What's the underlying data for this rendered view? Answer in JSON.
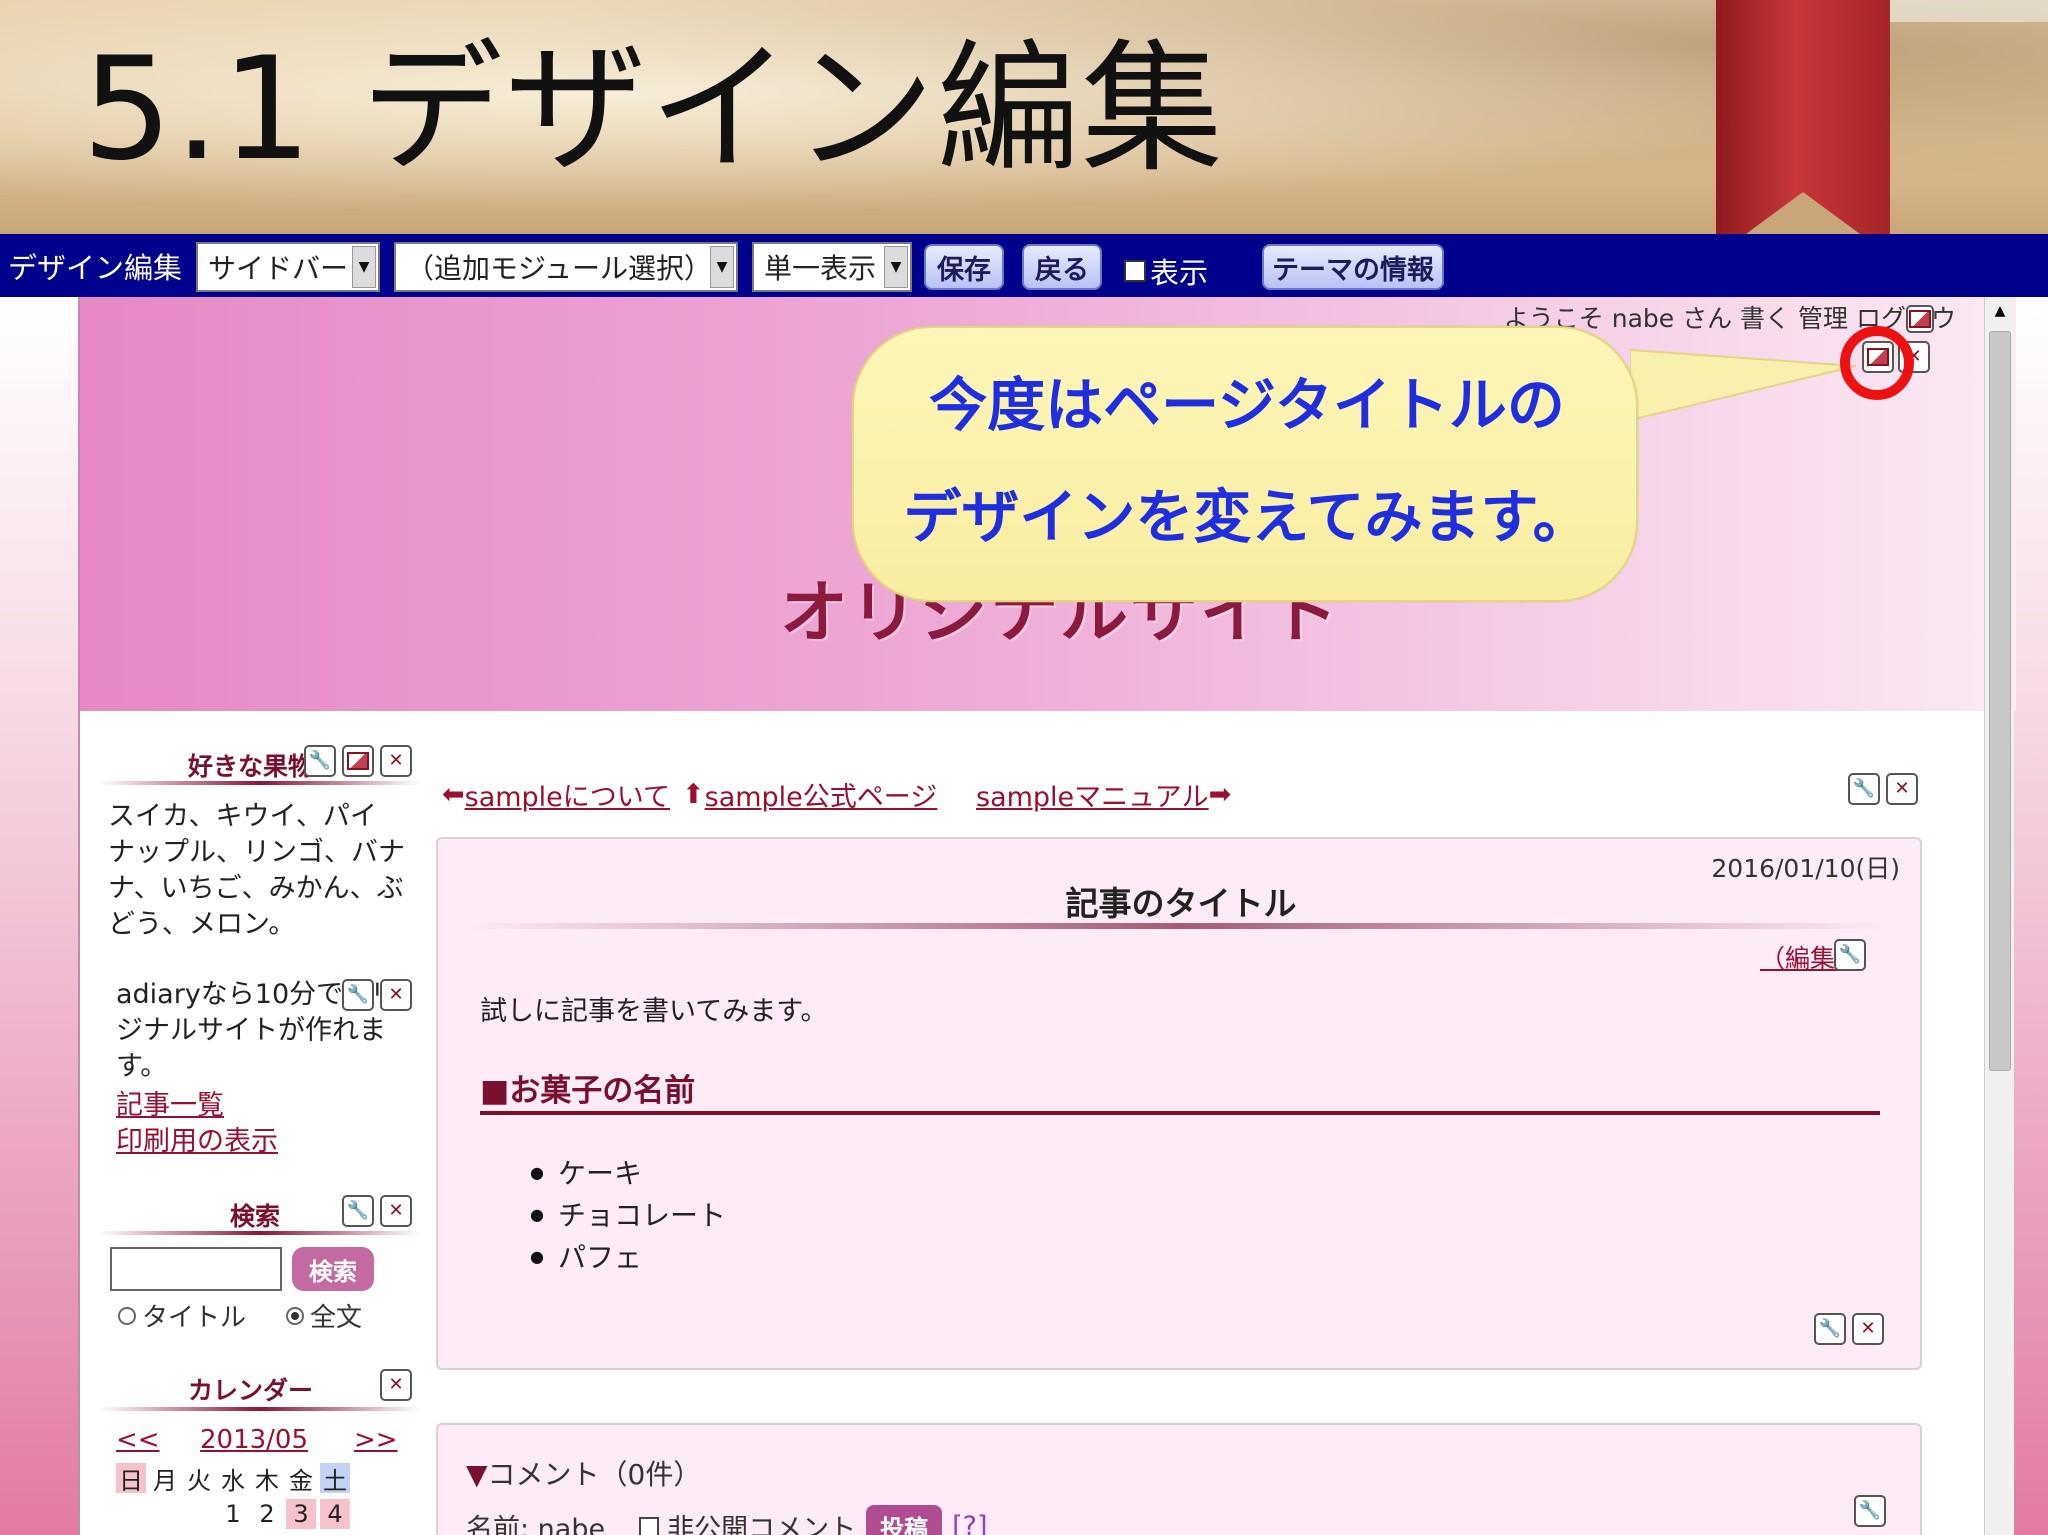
{
  "slide": {
    "title": "5.1 デザイン編集"
  },
  "toolbar": {
    "label": "デザイン編集",
    "select_sidebar": "サイドバー",
    "select_module": "（追加モジュール選択）",
    "select_view": "単一表示",
    "save_label": "保存",
    "back_label": "戻る",
    "display_checkbox_label": "表示",
    "theme_info_label": "テーマの情報"
  },
  "header": {
    "welcome": "ようこそ nabe さん",
    "write_link": "書く",
    "admin_link": "管理",
    "logout_link": "ログアウ",
    "site_title": "オリジナルサイト"
  },
  "callout": {
    "line1": "今度はページタイトルの",
    "line2": "デザインを変えてみます。"
  },
  "sidebar": {
    "fruits": {
      "heading": "好きな果物",
      "text_lines": [
        "スイカ、キウイ、パイ",
        "ナップル、リンゴ、バナ",
        "ナ、いちご、みかん、ぶ",
        "どう、メロン。"
      ]
    },
    "adiary": {
      "text_lines": [
        "adiaryなら10分でオリ",
        "ジナルサイトが作れま",
        "す。"
      ],
      "link_articles": "記事一覧",
      "link_print": "印刷用の表示"
    },
    "search": {
      "heading": "検索",
      "button": "検索",
      "radio_title": "タイトル",
      "radio_full": "全文"
    },
    "calendar": {
      "heading": "カレンダー",
      "prev": "<<",
      "month": "2013/05",
      "next": ">>",
      "weekdays": [
        "日",
        "月",
        "火",
        "水",
        "木",
        "金",
        "土"
      ],
      "first_row": [
        "1",
        "2",
        "3",
        "4"
      ]
    }
  },
  "main": {
    "nav": {
      "prev": "sampleについて",
      "up": "sample公式ページ",
      "next": "sampleマニュアル"
    },
    "article": {
      "date": "2016/01/10(日)",
      "title": "記事のタイトル",
      "edit": "（編集）",
      "body": "試しに記事を書いてみます。",
      "heading": "■お菓子の名前",
      "items": [
        "ケーキ",
        "チョコレート",
        "パフェ"
      ]
    },
    "comments": {
      "heading": "コメント（0件）",
      "name_label": "名前: nabe",
      "private_label": "非公開コメント",
      "post_button": "投稿",
      "help": "[?]"
    }
  },
  "colors": {
    "toolbar_bg": "#00008c",
    "accent": "#9a1030",
    "callout_text": "#1f2fe0",
    "highlight_ring": "#ee1111"
  }
}
